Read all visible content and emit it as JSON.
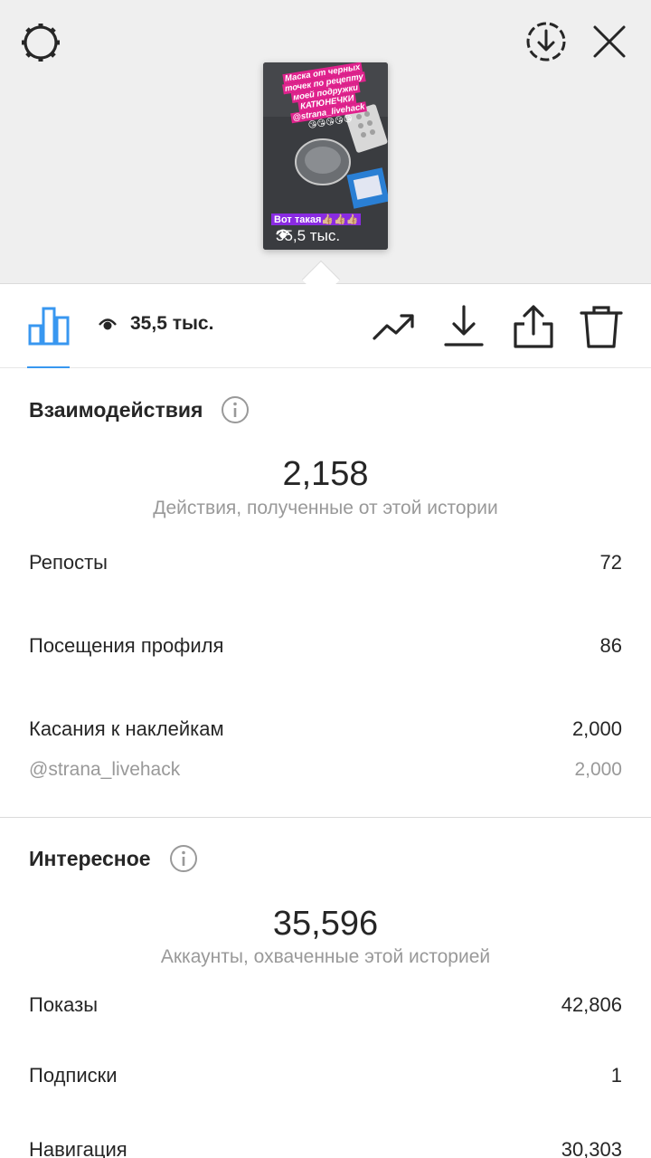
{
  "preview": {
    "caption_lines": [
      "Маска от черных",
      "точек по рецепту",
      "моей подружки",
      "КАТЮНЕЧКИ",
      "@strana_livehack"
    ],
    "emojis": "😘😘😘😘😘",
    "bottom_text": "Вот такая👍🏼👍🏼👍🏼",
    "views": "35,5 тыс."
  },
  "toolbar": {
    "views": "35,5 тыс.",
    "accent_color": "#3897f0"
  },
  "interactions": {
    "title": "Взаимодействия",
    "total": "2,158",
    "subtitle": "Действия, полученные от этой истории",
    "rows": [
      {
        "label": "Репосты",
        "value": "72"
      },
      {
        "label": "Посещения профиля",
        "value": "86"
      },
      {
        "label": "Касания к наклейкам",
        "value": "2,000"
      }
    ],
    "sub_row": {
      "label": "@strana_livehack",
      "value": "2,000"
    }
  },
  "discovery": {
    "title": "Интересное",
    "total": "35,596",
    "subtitle": "Аккаунты, охваченные этой историей",
    "rows": [
      {
        "label": "Показы",
        "value": "42,806"
      },
      {
        "label": "Подписки",
        "value": "1"
      },
      {
        "label": "Навигация",
        "value": "30,303"
      }
    ]
  }
}
